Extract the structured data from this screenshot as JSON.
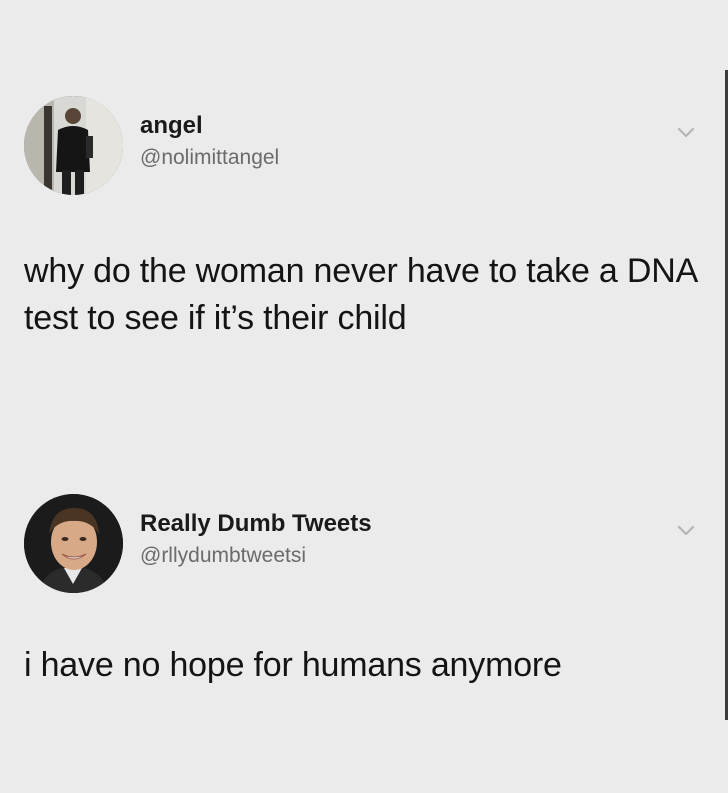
{
  "tweets": [
    {
      "display_name": "angel",
      "handle": "@nolimittangel",
      "text": "why do the woman never have to take a DNA test to see if it’s their child",
      "avatar_icon": "person-photo-avatar",
      "menu_icon": "chevron-down-icon"
    },
    {
      "display_name": "Really Dumb Tweets",
      "handle": "@rllydumbtweetsi",
      "text": "i have no hope for humans anymore",
      "avatar_icon": "smiling-man-photo-avatar",
      "menu_icon": "chevron-down-icon"
    }
  ],
  "colors": {
    "background": "#ebebeb",
    "text": "#141414",
    "handle": "#6b6b6b",
    "chevron": "#b5b5b5"
  }
}
